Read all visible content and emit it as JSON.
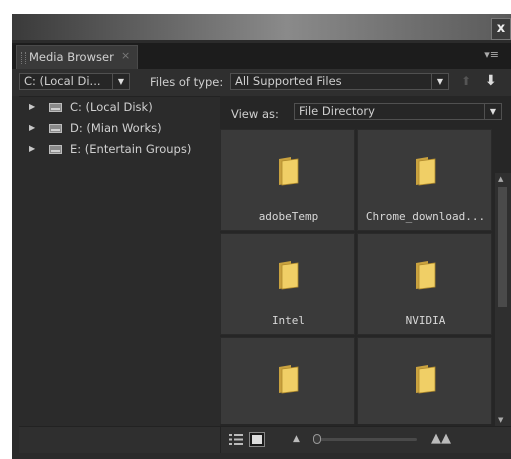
{
  "window": {
    "close_glyph": "x"
  },
  "panel": {
    "tab_label": "Media Browser",
    "tab_close": "×",
    "menu_glyph": "▾≡"
  },
  "toolbar": {
    "drive_select": "C: (Local Di...",
    "files_of_type_label": "Files of type:",
    "files_of_type_value": "All Supported Files"
  },
  "tree": {
    "items": [
      {
        "label": "C: (Local Disk)",
        "icon": "drive-icon"
      },
      {
        "label": "D: (Mian Works)",
        "icon": "drive-icon"
      },
      {
        "label": "E: (Entertain Groups)",
        "icon": "drive-icon"
      }
    ]
  },
  "view": {
    "view_as_label": "View as:",
    "view_as_value": "File Directory"
  },
  "grid": {
    "items": [
      {
        "label": "adobeTemp",
        "icon": "folder-icon"
      },
      {
        "label": "Chrome_download...",
        "icon": "folder-icon"
      },
      {
        "label": "Intel",
        "icon": "folder-icon"
      },
      {
        "label": "NVIDIA",
        "icon": "folder-icon"
      },
      {
        "label": "",
        "icon": "folder-icon"
      },
      {
        "label": "",
        "icon": "folder-icon"
      }
    ]
  },
  "zoom": {
    "level": 0.0
  },
  "colors": {
    "panel_bg": "#2b2b2b",
    "cell_bg": "#3a3a3a",
    "folder_fill": "#e8c65a"
  }
}
